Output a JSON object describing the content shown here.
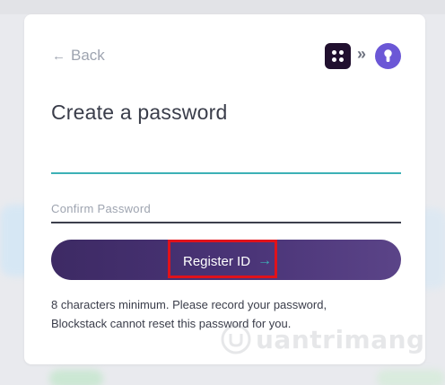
{
  "nav": {
    "back_label": "Back",
    "back_icon": "arrow-left-icon"
  },
  "header": {
    "app_icon": "blockstack-app-icon",
    "separator": "»",
    "key_icon": "keyhole-icon"
  },
  "form": {
    "title": "Create a password",
    "password_value": "",
    "confirm_placeholder": "Confirm Password",
    "submit_label": "Register ID",
    "submit_icon": "arrow-right-icon"
  },
  "help": {
    "line1": "8 characters minimum. Please record your password,",
    "line2": "Blockstack cannot reset this password for you."
  },
  "watermark": {
    "text": "uantrimang"
  },
  "colors": {
    "accent_teal": "#3cb1b6",
    "button_purple": "#4a3477",
    "highlight_red": "#e0121b",
    "key_badge": "#6b57d6",
    "app_icon_bg": "#21102f"
  }
}
